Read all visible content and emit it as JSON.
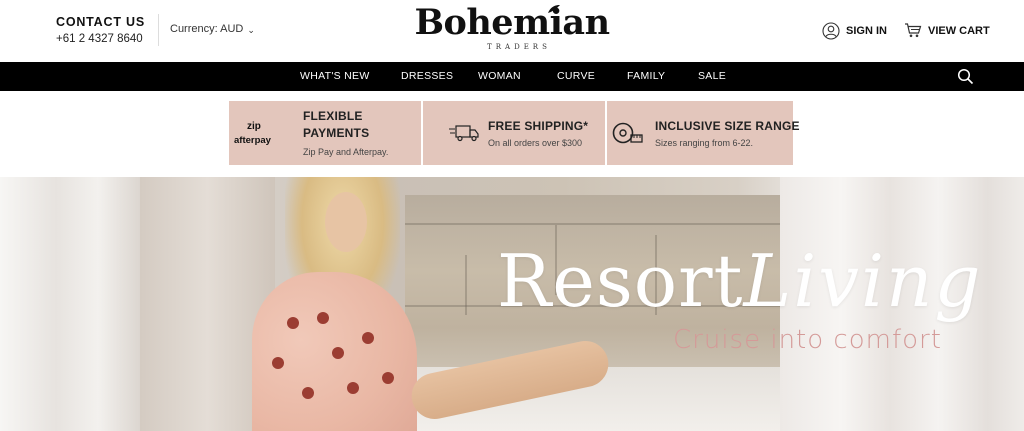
{
  "header": {
    "contact_title": "CONTACT US",
    "contact_phone": "+61 2 4327 8640",
    "currency_label": "Currency: AUD",
    "logo_main": "Bohemian",
    "logo_sub": "TRADERS",
    "signin_label": "SIGN IN",
    "cart_label": "VIEW CART"
  },
  "nav": {
    "items": [
      "WHAT'S NEW",
      "DRESSES",
      "WOMAN",
      "CURVE",
      "FAMILY",
      "SALE"
    ]
  },
  "promos": [
    {
      "icon": "zip-afterpay-logo",
      "title": "FLEXIBLE PAYMENTS",
      "subtitle": "Zip Pay and Afterpay.",
      "logo_zip": "zip",
      "logo_afterpay": "afterpay"
    },
    {
      "icon": "delivery-truck-icon",
      "title": "FREE SHIPPING*",
      "subtitle": "On all orders over $300"
    },
    {
      "icon": "measuring-tape-icon",
      "title": "INCLUSIVE SIZE RANGE",
      "subtitle": "Sizes ranging from 6-22."
    }
  ],
  "hero": {
    "title_main": "Resort",
    "title_script": "Living",
    "subtitle": "Cruise into comfort"
  },
  "colors": {
    "nav_bg": "#000000",
    "promo_bg": "#e3c6bc",
    "hero_subtitle": "#d49a98"
  }
}
